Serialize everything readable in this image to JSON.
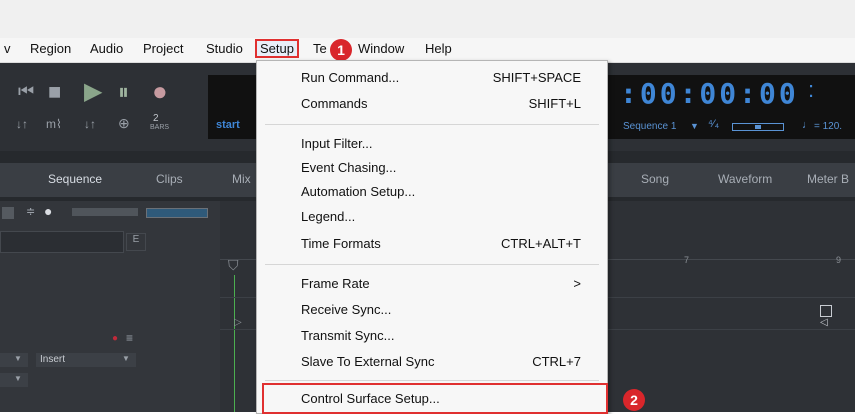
{
  "menubar": {
    "items": [
      "v",
      "Region",
      "Audio",
      "Project",
      "Studio",
      "Setup",
      "Te",
      "Window",
      "Help"
    ],
    "selected": "Setup"
  },
  "transport": {
    "counter": ":00:00:00",
    "counter_suffix": ":",
    "start_label": "start",
    "bars_count": "2",
    "bars_label": "BARS",
    "sequence_label": "Sequence 1",
    "tempo": "= 120."
  },
  "tabs": [
    "Sequence",
    "Clips",
    "Mix",
    "Song",
    "Waveform",
    "Meter B"
  ],
  "tracks": {
    "e_label": "E",
    "insert_label": "Insert",
    "ruler": [
      "7",
      "9"
    ]
  },
  "setup_menu": {
    "group1": [
      {
        "label": "Run Command...",
        "shortcut": "SHIFT+SPACE"
      },
      {
        "label": "Commands",
        "shortcut": "SHIFT+L"
      }
    ],
    "group2": [
      {
        "label": "Input Filter..."
      },
      {
        "label": "Event Chasing..."
      },
      {
        "label": "Automation Setup..."
      },
      {
        "label": "Legend..."
      },
      {
        "label": "Time Formats",
        "shortcut": "CTRL+ALT+T"
      }
    ],
    "group3": [
      {
        "label": "Frame Rate",
        "shortcut": ">"
      },
      {
        "label": "Receive Sync..."
      },
      {
        "label": "Transmit Sync..."
      },
      {
        "label": "Slave To External Sync",
        "shortcut": "CTRL+7"
      }
    ],
    "group4": [
      {
        "label": "Control Surface Setup..."
      }
    ]
  },
  "badges": {
    "one": "1",
    "two": "2"
  },
  "colors": {
    "highlight": "#e03030",
    "badge": "#d9262b",
    "app_bg": "#26292d",
    "counter": "#3f86d6"
  }
}
